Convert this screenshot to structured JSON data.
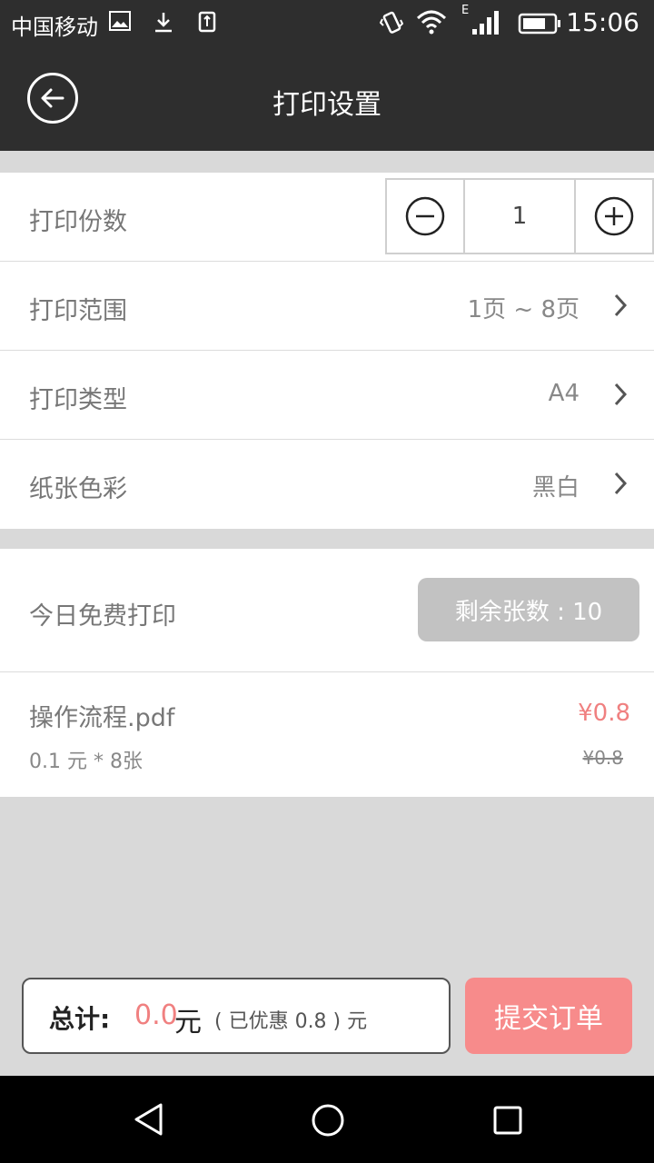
{
  "status_bar": {
    "carrier": "中国移动",
    "network": "E",
    "time": "15:06",
    "icons": [
      "image-icon",
      "download-icon",
      "upload-icon",
      "vibrate-icon",
      "wifi-icon",
      "signal-icon",
      "battery-icon"
    ]
  },
  "header": {
    "title": "打印设置",
    "back_icon": "back-arrow-icon"
  },
  "settings": {
    "copies": {
      "label": "打印份数",
      "value": "1"
    },
    "range": {
      "label": "打印范围",
      "value": "1页 ~ 8页"
    },
    "type": {
      "label": "打印类型",
      "value": "A4"
    },
    "color": {
      "label": "纸张色彩",
      "value": "黑白"
    }
  },
  "free_print": {
    "label": "今日免费打印",
    "remaining": "剩余张数 : 10"
  },
  "file": {
    "name": "操作流程.pdf",
    "detail": "0.1 元 * 8张",
    "price": "¥0.8",
    "original_price": "¥0.8"
  },
  "footer": {
    "total_label": "总计:",
    "total_amount": "0.0",
    "total_unit": "元",
    "discount_text": "( 已优惠 0.8 ) 元",
    "submit_label": "提交订单"
  },
  "colors": {
    "header_bg": "#2e2e2e",
    "accent": "#f78b8b",
    "price": "#f08080",
    "badge_bg": "#c2c2c2"
  }
}
